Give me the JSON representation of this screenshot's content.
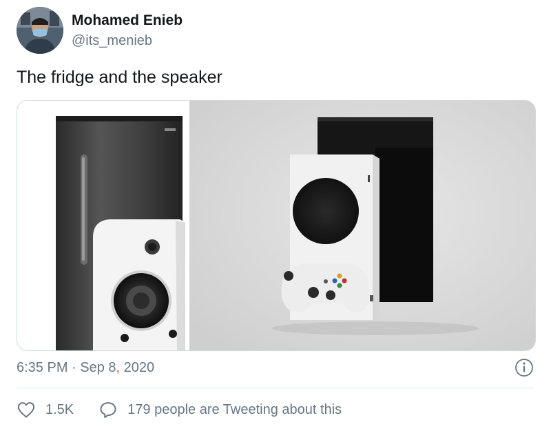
{
  "author": {
    "name": "Mohamed Enieb",
    "handle": "@its_menieb"
  },
  "tweet": {
    "text": "The fridge and the speaker",
    "timestamp": "6:35 PM · Sep 8, 2020"
  },
  "actions": {
    "likes": "1.5K",
    "conversation": "179 people are Tweeting about this"
  },
  "icons": {
    "info": "info-icon",
    "like": "heart-icon",
    "conversation": "speech-bubble-icon"
  },
  "colors": {
    "text_primary": "#14171a",
    "text_secondary": "#657786",
    "divider": "#e1e8ed"
  }
}
